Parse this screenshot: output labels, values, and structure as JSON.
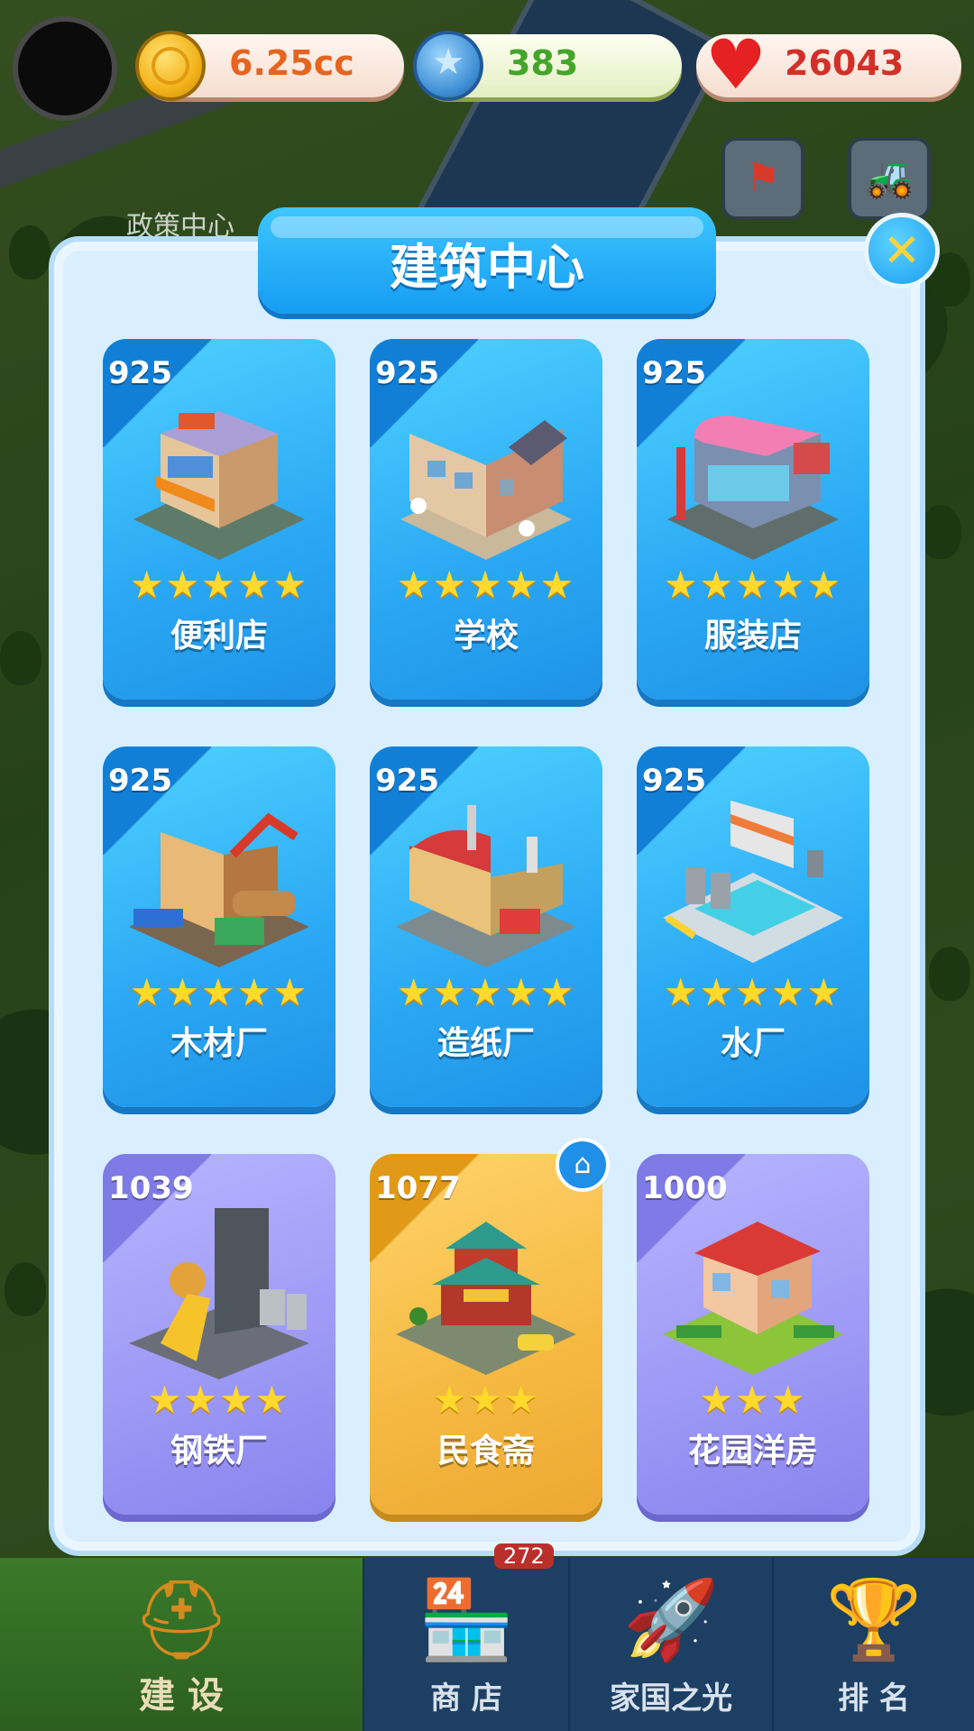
{
  "hud": {
    "coins": "6.25cc",
    "stars": "383",
    "hearts": "26043",
    "coin_color": "#f3b31b",
    "star_color": "#3e8fd4",
    "heart_color": "#e52121"
  },
  "map_label": "政策中心",
  "panel": {
    "title": "建筑中心",
    "close_icon": "close-icon"
  },
  "buildings": [
    {
      "price": "925",
      "name": "便利店",
      "stars": "★★★★★",
      "style": "blue"
    },
    {
      "price": "925",
      "name": "学校",
      "stars": "★★★★★",
      "style": "blue"
    },
    {
      "price": "925",
      "name": "服装店",
      "stars": "★★★★★",
      "style": "blue"
    },
    {
      "price": "925",
      "name": "木材厂",
      "stars": "★★★★★",
      "style": "blue"
    },
    {
      "price": "925",
      "name": "造纸厂",
      "stars": "★★★★★",
      "style": "blue"
    },
    {
      "price": "925",
      "name": "水厂",
      "stars": "★★★★★",
      "style": "blue"
    },
    {
      "price": "1039",
      "name": "钢铁厂",
      "stars": "★★★★",
      "style": "purple"
    },
    {
      "price": "1077",
      "name": "民食斋",
      "stars": "★★★",
      "style": "gold"
    },
    {
      "price": "1000",
      "name": "花园洋房",
      "stars": "★★★",
      "style": "purple"
    }
  ],
  "bottom_nav": {
    "badge": "272",
    "tabs": [
      {
        "label": "建 设",
        "icon": "hardhat-icon"
      },
      {
        "label": "商 店",
        "icon": "shop-icon"
      },
      {
        "label": "家国之光",
        "icon": "rocket-icon"
      },
      {
        "label": "排 名",
        "icon": "ranking-icon"
      }
    ]
  }
}
